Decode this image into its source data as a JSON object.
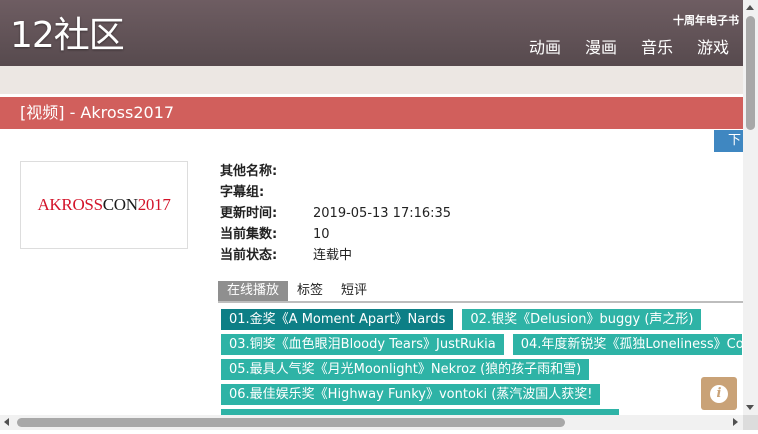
{
  "header": {
    "logo": "12社区",
    "ebook_link": "十周年电子书",
    "nav": [
      "动画",
      "漫画",
      "音乐",
      "游戏"
    ]
  },
  "page": {
    "title": "[视频] - Akross2017",
    "download_tab": "下载"
  },
  "cover": {
    "text_part1": "AKROSS",
    "text_part2": "CON",
    "text_part3": "2017"
  },
  "info": [
    {
      "label": "其他名称:",
      "value": ""
    },
    {
      "label": "字幕组:",
      "value": ""
    },
    {
      "label": "更新时间:",
      "value": "2019-05-13 17:16:35"
    },
    {
      "label": "当前集数:",
      "value": "10"
    },
    {
      "label": "当前状态:",
      "value": "连载中"
    }
  ],
  "tabs": [
    "在线播放",
    "标签",
    "短评"
  ],
  "episodes": [
    "01.金奖《A Moment Apart》Nards",
    "02.银奖《Delusion》buggy (声之形)",
    "03.铜奖《血色眼泪Bloody Tears》JustRukia",
    "04.年度新锐奖《孤独Loneliness》Co",
    "05.最具人气奖《月光Moonlight》Nekroz (狼的孩子雨和雪)",
    "06.最佳娱乐奖《Highway Funky》vontoki (蒸汽波国人获奖!"
  ],
  "colors": {
    "header_bg": "#6e5d62",
    "title_bar": "#d15f5c",
    "episode": "#2eb3a6",
    "episode_active": "#0d7f86",
    "download_tab": "#3f87c1"
  },
  "icons": {
    "info": "info-circle-icon"
  }
}
